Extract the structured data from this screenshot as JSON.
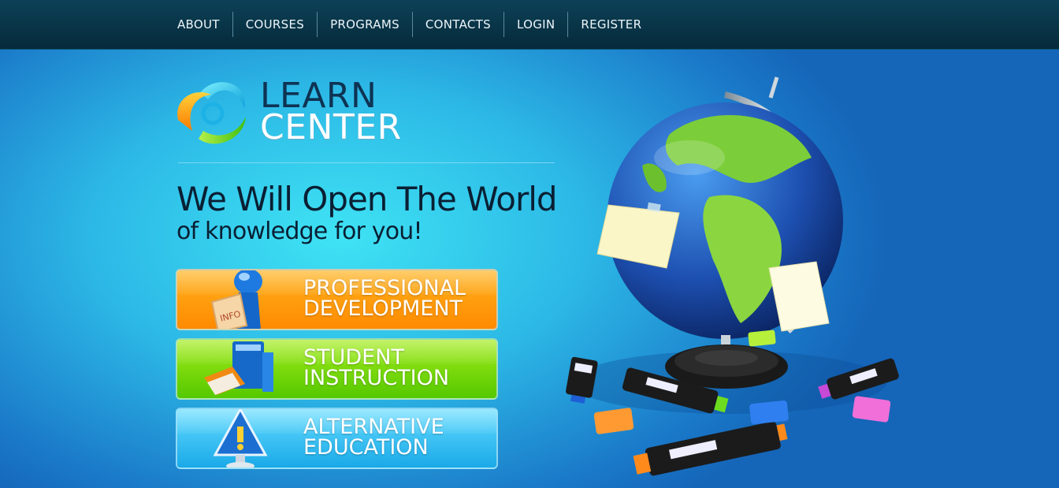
{
  "nav": {
    "items": [
      "ABOUT",
      "COURSES",
      "PROGRAMS",
      "CONTACTS",
      "LOGIN",
      "REGISTER"
    ]
  },
  "logo": {
    "line1": "LEARN",
    "line2": "CENTER"
  },
  "hero": {
    "headline": "We Will Open The World",
    "subline": "of knowledge for you!"
  },
  "programs": [
    {
      "line1": "PROFESSIONAL",
      "line2": "DEVELOPMENT",
      "icon": "info-figure-icon",
      "color": "#ff9a00"
    },
    {
      "line1": "STUDENT",
      "line2": "INSTRUCTION",
      "icon": "books-icon",
      "color": "#7ddc0a"
    },
    {
      "line1": "ALTERNATIVE",
      "line2": "EDUCATION",
      "icon": "warning-monitor-icon",
      "color": "#2fbcef"
    }
  ],
  "colors": {
    "topbar": "#062a3a",
    "accent_dark": "#0e3353"
  },
  "illustration": {
    "icon": "globe-with-markers-icon"
  }
}
